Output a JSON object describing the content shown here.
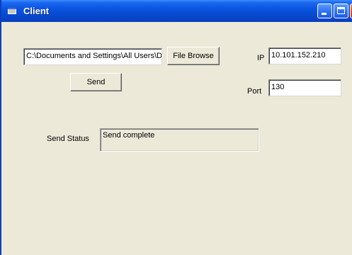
{
  "window": {
    "title": "Client",
    "titlebar_color": "#0a55e0",
    "face_color": "#ece9d8"
  },
  "title_buttons": {
    "minimize_icon": "minimize-icon",
    "maximize_icon": "maximize-icon",
    "close_icon": "close-icon"
  },
  "file": {
    "path_value": "C:\\Documents and Settings\\All Users\\Docur",
    "browse_label": "File Browse",
    "send_label": "Send"
  },
  "connection": {
    "ip_label": "IP",
    "ip_value": "10.101.152.210",
    "port_label": "Port",
    "port_value": "130"
  },
  "status": {
    "label": "Send Status",
    "value": "Send complete"
  }
}
